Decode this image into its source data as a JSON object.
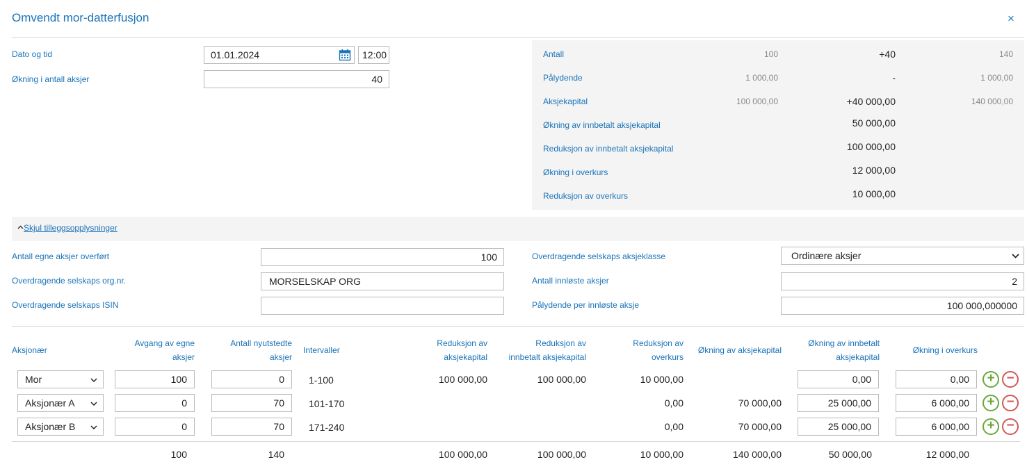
{
  "dialog": {
    "title": "Omvendt mor-datterfusjon",
    "close": "×"
  },
  "form": {
    "date_label": "Dato og tid",
    "date_value": "01.01.2024",
    "time_value": "12:00",
    "increase_label": "Økning i antall aksjer",
    "increase_value": "40"
  },
  "summary": {
    "rows": [
      {
        "label": "Antall",
        "before": "100",
        "delta": "+40",
        "after": "140"
      },
      {
        "label": "Pålydende",
        "before": "1 000,00",
        "delta": "-",
        "after": "1 000,00"
      },
      {
        "label": "Aksjekapital",
        "before": "100 000,00",
        "delta": "+40 000,00",
        "after": "140 000,00"
      },
      {
        "label": "Økning av innbetalt aksjekapital",
        "before": "",
        "delta": "50 000,00",
        "after": ""
      },
      {
        "label": "Reduksjon av innbetalt aksjekapital",
        "before": "",
        "delta": "100 000,00",
        "after": ""
      },
      {
        "label": "Økning i overkurs",
        "before": "",
        "delta": "12 000,00",
        "after": ""
      },
      {
        "label": "Reduksjon av overkurs",
        "before": "",
        "delta": "10 000,00",
        "after": ""
      }
    ]
  },
  "extra": {
    "toggle_label": "Skjul tilleggsopplysninger",
    "own_shares_label": "Antall egne aksjer overført",
    "own_shares_value": "100",
    "orgnr_label": "Overdragende selskaps org.nr.",
    "orgnr_value": "MORSELSKAP ORG",
    "isin_label": "Overdragende selskaps ISIN",
    "isin_value": "",
    "class_label": "Overdragende selskaps aksjeklasse",
    "class_value": "Ordinære aksjer",
    "redeemed_label": "Antall innløste aksjer",
    "redeemed_value": "2",
    "par_label": "Pålydende per innløste aksje",
    "par_value": "100 000,000000"
  },
  "table": {
    "headers": {
      "shareholder": "Aksjonær",
      "own_out_1": "Avgang av egne",
      "own_out_2": "aksjer",
      "new_1": "Antall nyutstedte",
      "new_2": "aksjer",
      "intervals": "Intervaller",
      "red_cap_1": "Reduksjon av",
      "red_cap_2": "aksjekapital",
      "red_paid_1": "Reduksjon av",
      "red_paid_2": "innbetalt aksjekapital",
      "red_over_1": "Reduksjon av",
      "red_over_2": "overkurs",
      "inc_cap": "Økning av aksjekapital",
      "inc_paid_1": "Økning av innbetalt",
      "inc_paid_2": "aksjekapital",
      "inc_over": "Økning i overkurs"
    },
    "rows": [
      {
        "shareholder": "Mor",
        "own_out": "100",
        "new": "0",
        "interval": "1-100",
        "red_cap": "100 000,00",
        "red_paid": "100 000,00",
        "red_over": "10 000,00",
        "inc_cap": "",
        "inc_paid": "0,00",
        "inc_over": "0,00"
      },
      {
        "shareholder": "Aksjonær A",
        "own_out": "0",
        "new": "70",
        "interval": "101-170",
        "red_cap": "",
        "red_paid": "",
        "red_over": "0,00",
        "inc_cap": "70 000,00",
        "inc_paid": "25 000,00",
        "inc_over": "6 000,00"
      },
      {
        "shareholder": "Aksjonær B",
        "own_out": "0",
        "new": "70",
        "interval": "171-240",
        "red_cap": "",
        "red_paid": "",
        "red_over": "0,00",
        "inc_cap": "70 000,00",
        "inc_paid": "25 000,00",
        "inc_over": "6 000,00"
      }
    ],
    "totals": {
      "own_out": "100",
      "new": "140",
      "red_cap": "100 000,00",
      "red_paid": "100 000,00",
      "red_over": "10 000,00",
      "inc_cap": "140 000,00",
      "inc_paid": "50 000,00",
      "inc_over": "12 000,00"
    }
  },
  "icons": {
    "calendar": "calendar-icon",
    "chevron_up": "chevron-up-icon",
    "chevron_down": "chevron-down-icon",
    "plus": "plus-icon",
    "minus": "minus-icon"
  },
  "colors": {
    "accent": "#1a73b8",
    "plus": "#6aa83a",
    "minus": "#d05757"
  }
}
